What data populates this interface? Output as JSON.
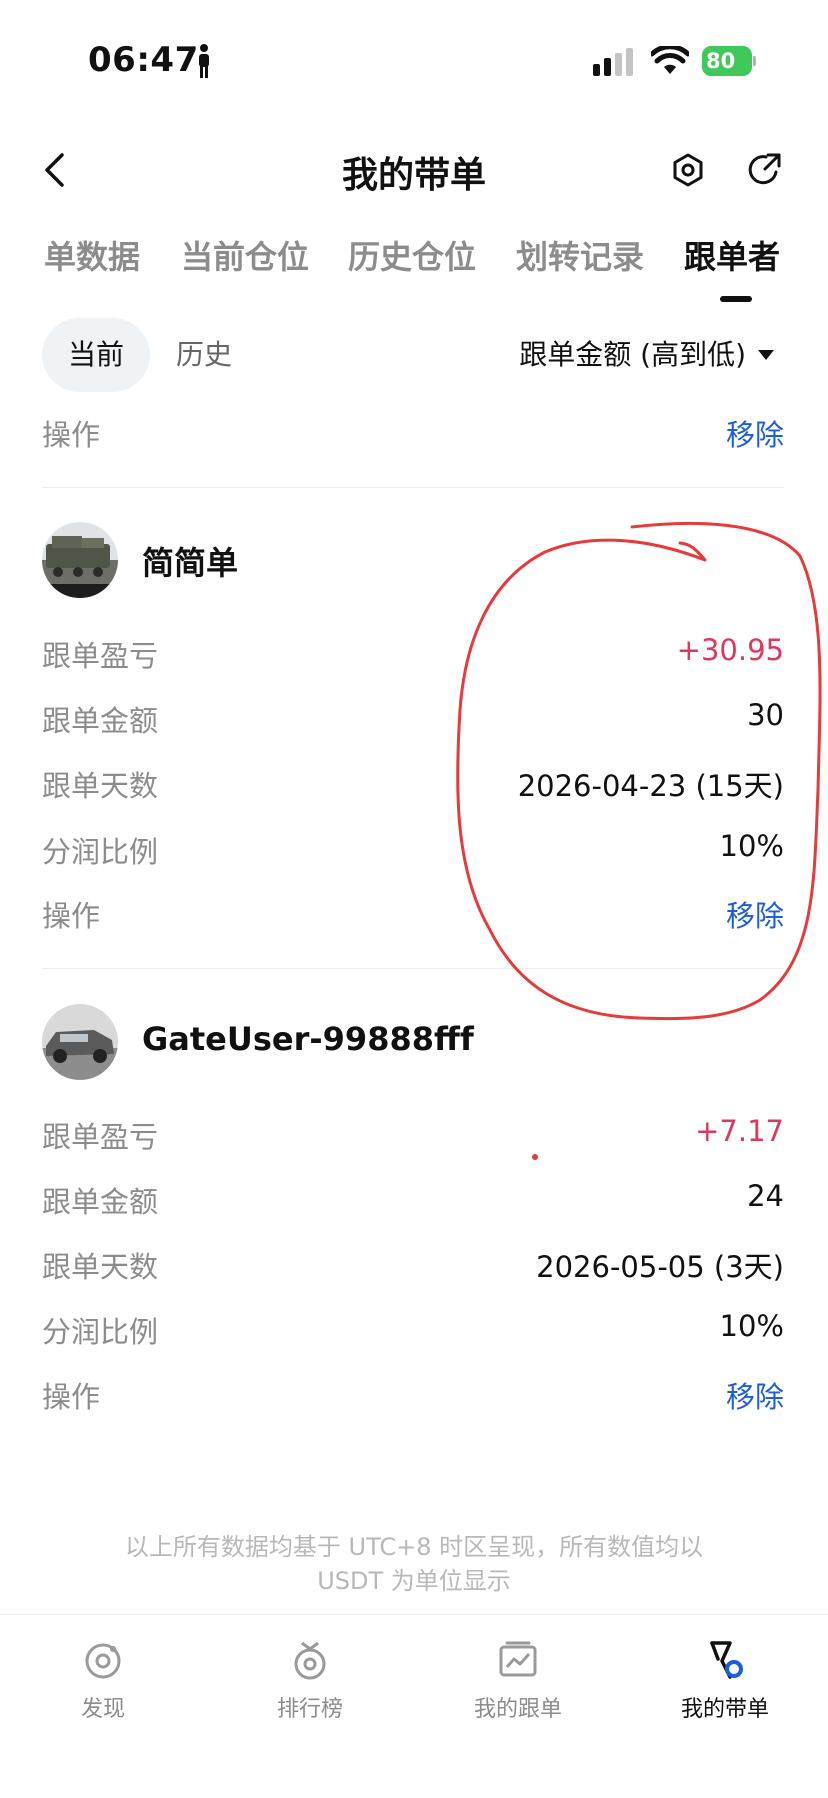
{
  "status_bar": {
    "time": "06:47",
    "battery": "80"
  },
  "header": {
    "title": "我的带单"
  },
  "tabs": [
    {
      "label": "单数据"
    },
    {
      "label": "当前仓位"
    },
    {
      "label": "历史仓位"
    },
    {
      "label": "划转记录"
    },
    {
      "label": "跟单者",
      "active": true
    }
  ],
  "subbar": {
    "current": "当前",
    "history": "历史",
    "sort_label": "跟单金额 (高到低)"
  },
  "partial_row": {
    "label": "操作",
    "action": "移除"
  },
  "followers": [
    {
      "name": "简简单",
      "rows": [
        {
          "label": "跟单盈亏",
          "value": "+30.95"
        },
        {
          "label": "跟单金额",
          "value": "30"
        },
        {
          "label": "跟单天数",
          "value": "2026-04-23 (15天)"
        },
        {
          "label": "分润比例",
          "value": "10%"
        },
        {
          "label": "操作",
          "value": "移除"
        }
      ]
    },
    {
      "name": "GateUser-99888fff",
      "rows": [
        {
          "label": "跟单盈亏",
          "value": "+7.17"
        },
        {
          "label": "跟单金额",
          "value": "24"
        },
        {
          "label": "跟单天数",
          "value": "2026-05-05 (3天)"
        },
        {
          "label": "分润比例",
          "value": "10%"
        },
        {
          "label": "操作",
          "value": "移除"
        }
      ]
    }
  ],
  "footnote": {
    "line1": "以上所有数据均基于 UTC+8 时区呈现，所有数值均以",
    "line2": "USDT 为单位显示"
  },
  "bottom_nav": [
    {
      "label": "发现",
      "icon": "discover-icon"
    },
    {
      "label": "排行榜",
      "icon": "ranking-icon"
    },
    {
      "label": "我的跟单",
      "icon": "my-copy-icon"
    },
    {
      "label": "我的带单",
      "icon": "my-lead-icon",
      "active": true
    }
  ],
  "colors": {
    "positive": "#e0375c",
    "action": "#1f5de0",
    "annotation": "#e83a3a"
  }
}
